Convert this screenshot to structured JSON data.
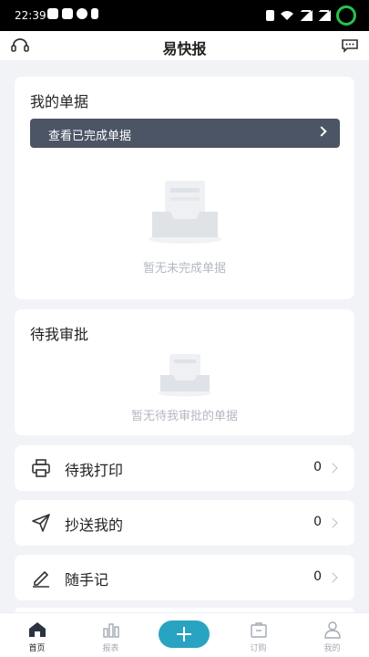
{
  "status_bar": {
    "time": "22:39"
  },
  "header": {
    "title": "易快报",
    "left_icon": "headset-icon",
    "right_icon": "message-icon"
  },
  "my_documents": {
    "title": "我的单据",
    "view_completed_label": "查看已完成单据",
    "empty_text": "暂无未完成单据"
  },
  "pending_approval": {
    "title": "待我审批",
    "empty_text": "暂无待我审批的单据"
  },
  "list": [
    {
      "label": "待我打印",
      "count": "0",
      "icon": "printer-icon"
    },
    {
      "label": "抄送我的",
      "count": "0",
      "icon": "send-icon"
    },
    {
      "label": "随手记",
      "count": "0",
      "icon": "pen-icon"
    }
  ],
  "tabbar": {
    "tabs": [
      {
        "label": "首页",
        "icon": "home-icon",
        "active": true
      },
      {
        "label": "报表",
        "icon": "chart-icon",
        "active": false
      },
      {
        "label": "",
        "icon": "plus-icon",
        "active": false
      },
      {
        "label": "订购",
        "icon": "bag-icon",
        "active": false
      },
      {
        "label": "我的",
        "icon": "user-icon",
        "active": false
      }
    ]
  },
  "colors": {
    "accent": "#29a3c2",
    "button_dark": "#4b5565",
    "background": "#f2f3f6"
  }
}
